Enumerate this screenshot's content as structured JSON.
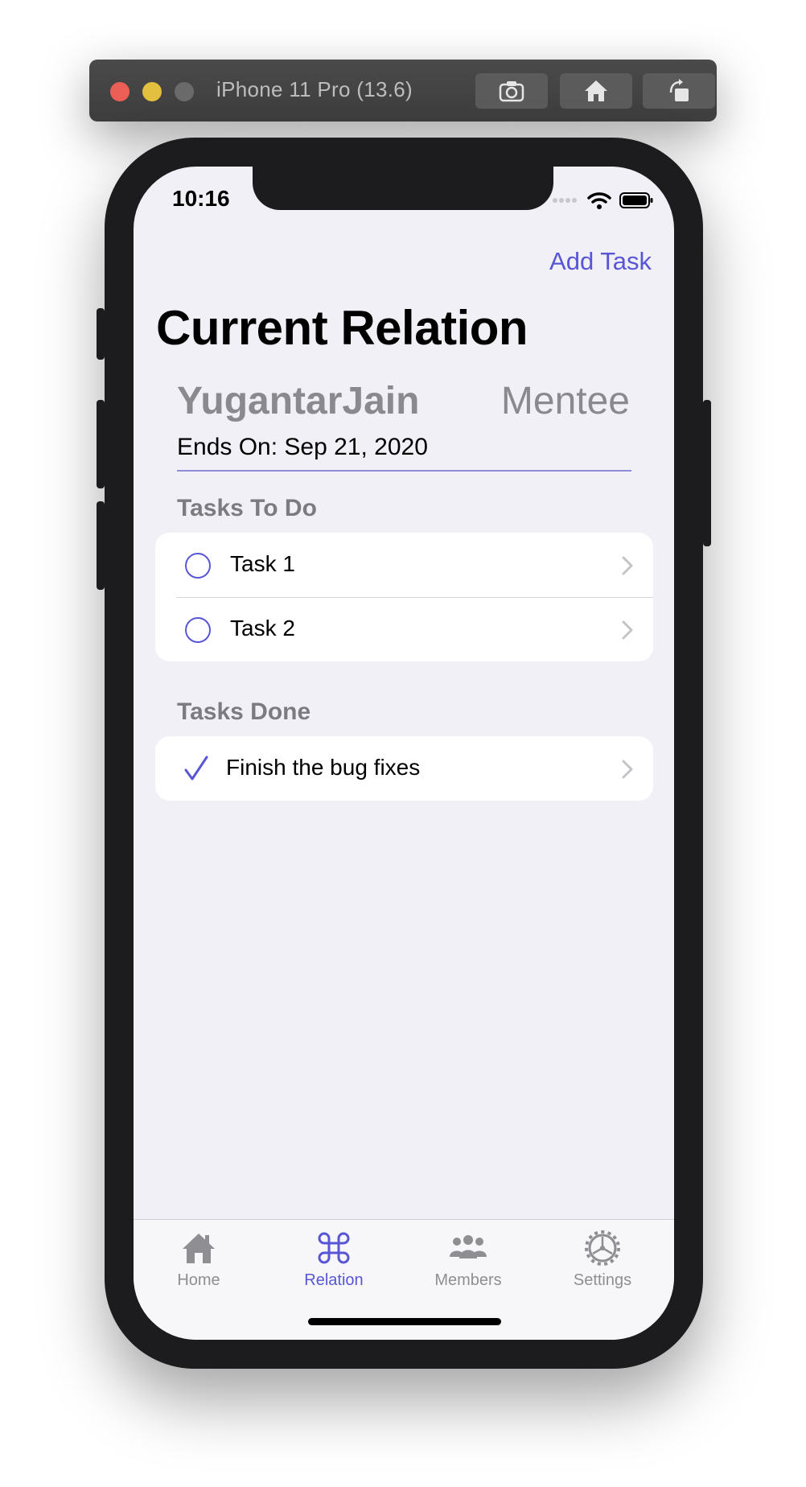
{
  "simulator": {
    "title": "iPhone 11 Pro (13.6)"
  },
  "status_bar": {
    "time": "10:16"
  },
  "nav": {
    "add_task": "Add Task",
    "title": "Current Relation"
  },
  "relation": {
    "name": "YugantarJain",
    "role": "Mentee",
    "ends_on": "Ends On: Sep 21, 2020"
  },
  "tasks_todo": {
    "header": "Tasks To Do",
    "items": [
      {
        "label": "Task 1"
      },
      {
        "label": "Task 2"
      }
    ]
  },
  "tasks_done": {
    "header": "Tasks Done",
    "items": [
      {
        "label": "Finish the bug fixes"
      }
    ]
  },
  "tabbar": {
    "tabs": [
      {
        "label": "Home",
        "icon": "house-icon"
      },
      {
        "label": "Relation",
        "icon": "command-icon",
        "active": true
      },
      {
        "label": "Members",
        "icon": "people-icon"
      },
      {
        "label": "Settings",
        "icon": "gear-icon"
      }
    ]
  },
  "colors": {
    "accent": "#5856d6",
    "secondary_text": "#8a8a8e",
    "background": "#f1f0f6"
  }
}
